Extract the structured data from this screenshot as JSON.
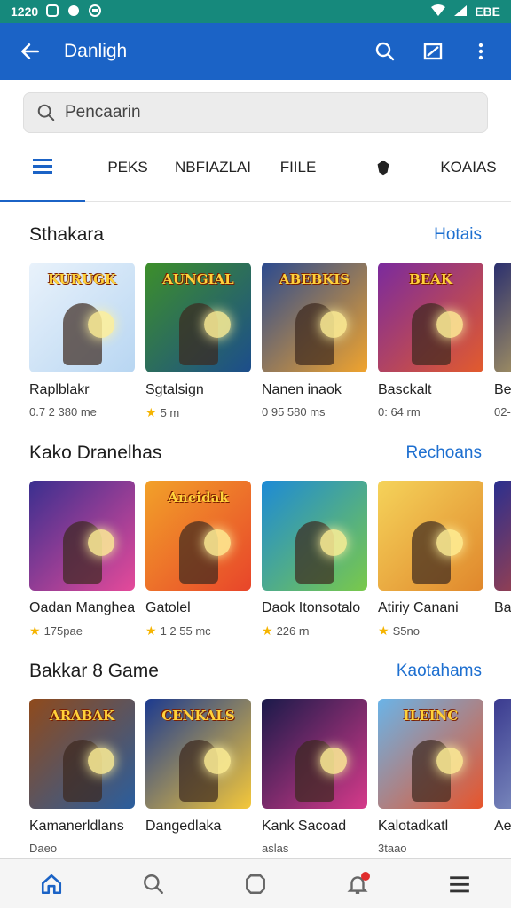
{
  "status_bar": {
    "time": "1220",
    "right_label": "EBE"
  },
  "app_bar": {
    "title": "Danligh"
  },
  "search": {
    "placeholder": "Pencaarin"
  },
  "tabs": [
    {
      "label": ""
    },
    {
      "label": "PEKS"
    },
    {
      "label": "NBFIAZLAI"
    },
    {
      "label": "FIILE"
    },
    {
      "label": ""
    },
    {
      "label": "KOAIAS"
    }
  ],
  "sections": [
    {
      "title": "Sthakara",
      "link": "Hotais",
      "items": [
        {
          "name": "Raplblakr",
          "meta": "0.7 2 380 me",
          "art": "KURUGK",
          "colors": [
            "#e9f2fb",
            "#b8d6f2"
          ]
        },
        {
          "name": "Sgtalsign",
          "meta": "5 m",
          "art": "AUNGIAL",
          "colors": [
            "#3d8f2a",
            "#1c4d8c"
          ],
          "star": true
        },
        {
          "name": "Nanen inaok",
          "meta": "0 95 580 ms",
          "art": "ABEBKIS",
          "colors": [
            "#2b4a8f",
            "#f1a42d"
          ]
        },
        {
          "name": "Basckalt",
          "meta": "0: 64 rm",
          "art": "BEAK",
          "colors": [
            "#7a2a9e",
            "#e35b2c"
          ]
        },
        {
          "name": "Bed",
          "meta": "02-",
          "art": "",
          "colors": [
            "#2a2f6f",
            "#e8c95a"
          ]
        }
      ]
    },
    {
      "title": "Kako Dranelhas",
      "link": "Rechoans",
      "items": [
        {
          "name": "Oadan Manghear",
          "meta": "175pae",
          "art": "",
          "colors": [
            "#3a2f8f",
            "#e54a9a"
          ],
          "star": true
        },
        {
          "name": "Gatolel",
          "meta": "1 2 55 mc",
          "art": "Aneidak",
          "colors": [
            "#f2a129",
            "#e8452a"
          ],
          "star": true
        },
        {
          "name": "Daok Itonsotalo",
          "meta": "226 rn",
          "art": "",
          "colors": [
            "#1d8ad6",
            "#7ac94a"
          ],
          "star": true
        },
        {
          "name": "Atiriy Canani",
          "meta": "S5no",
          "art": "",
          "colors": [
            "#f5d35a",
            "#e0872c"
          ],
          "star": true
        },
        {
          "name": "Ban",
          "meta": "",
          "art": "",
          "colors": [
            "#2a2f8f",
            "#d64a2c"
          ]
        }
      ]
    },
    {
      "title": "Bakkar 8 Game",
      "link": "Kaotahams",
      "items": [
        {
          "name": "Kamanerldlans",
          "meta": "Daeo",
          "art": "ARABAK",
          "colors": [
            "#8f4a1c",
            "#2a5e9e"
          ]
        },
        {
          "name": "Dangedlaka",
          "meta": "",
          "art": "CENKALS",
          "colors": [
            "#1c3a8f",
            "#f5c83a"
          ]
        },
        {
          "name": "Kank Sacoad",
          "meta": "aslas",
          "art": "",
          "colors": [
            "#1a1a4a",
            "#d63a8a"
          ]
        },
        {
          "name": "Kalotadkatl",
          "meta": "3taao",
          "art": "ILEINC",
          "colors": [
            "#6ab4e8",
            "#e8542a"
          ]
        },
        {
          "name": "Aed",
          "meta": "",
          "art": "",
          "colors": [
            "#3a3a8f",
            "#a0b8d8"
          ]
        }
      ]
    }
  ],
  "icons": {
    "back": "arrow-left-icon",
    "search": "search-icon",
    "compose": "compose-icon",
    "more": "more-vert-icon",
    "home": "home-icon",
    "notifications": "bell-icon",
    "menu": "menu-icon"
  },
  "colors": {
    "primary": "#1b63c6",
    "status": "#16897c",
    "link": "#1d6fd0"
  }
}
